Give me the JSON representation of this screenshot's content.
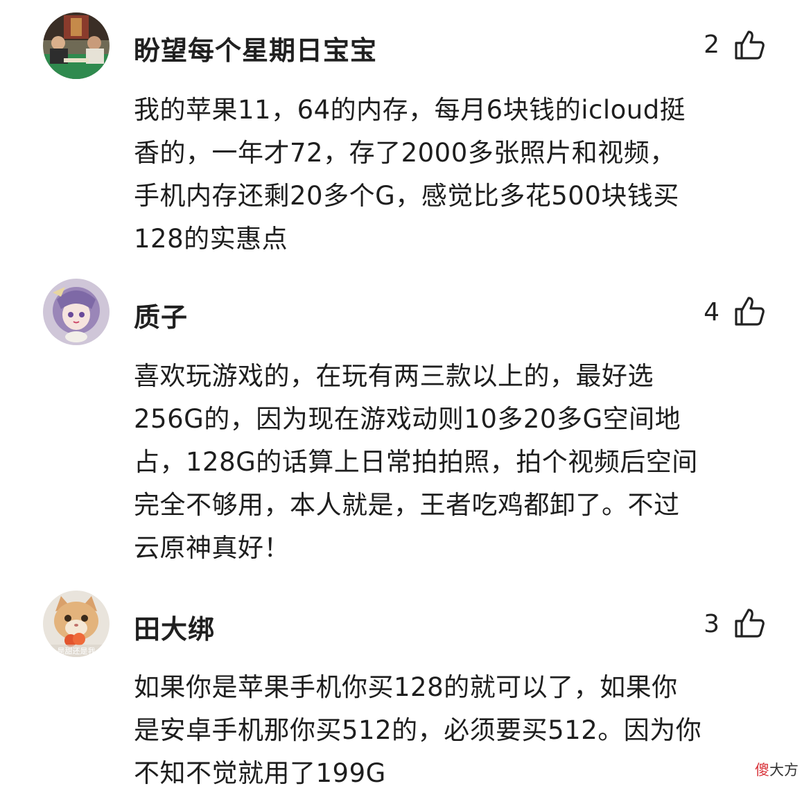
{
  "comments": [
    {
      "username": "盼望每个星期日宝宝",
      "likes": "2",
      "avatar_icon": "avatar-photo-two-men",
      "lines": [
        "我的苹果11，64的内存，每月6块钱的icloud挺",
        "香的，一年才72，存了2000多张照片和视频，",
        "手机内存还剩20多个G，感觉比多花500块钱买",
        "128的实惠点"
      ]
    },
    {
      "username": "质子",
      "likes": "4",
      "avatar_icon": "avatar-anime-girl",
      "lines": [
        "喜欢玩游戏的，在玩有两三款以上的，最好选",
        "256G的，因为现在游戏动则10多20多G空间地",
        "占，128G的话算上日常拍拍照，拍个视频后空间",
        "完全不够用，本人就是，王者吃鸡都卸了。不过",
        "云原神真好！"
      ]
    },
    {
      "username": "田大绑",
      "likes": "3",
      "avatar_icon": "avatar-cat",
      "avatar_caption": "是甜还是我",
      "lines": [
        "如果你是苹果手机你买128的就可以了，如果你",
        "是安卓手机那你买512的，必须要买512。因为你",
        "不知不觉就用了199G"
      ]
    }
  ],
  "watermark": {
    "first_char": "傻",
    "rest": "大方"
  },
  "colors": {
    "text": "#1e1e1e",
    "watermark_accent": "#d8333a"
  }
}
